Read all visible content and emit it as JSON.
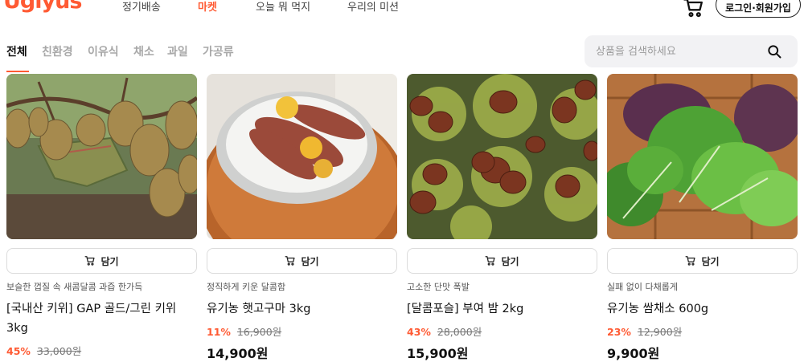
{
  "header": {
    "logo_text": "Uglyus",
    "nav": [
      "정기배송",
      "마켓",
      "오늘 뭐 먹지",
      "우리의 미션"
    ],
    "active_nav": "마켓",
    "login_label": "로그인·회원가입",
    "accent_color": "#ff5a33"
  },
  "categories": {
    "tabs": [
      "전체",
      "친환경",
      "이유식",
      "채소",
      "과일",
      "가공류"
    ],
    "active": "전체"
  },
  "search": {
    "placeholder": "상품을 검색하세요"
  },
  "products": [
    {
      "image": "kiwi-photo",
      "add_label": "담기",
      "subtitle": "보슬한 껍질 속 새콤달콤 과즙 한가득",
      "title": "[국내산 키위] GAP 골드/그린 키위 3kg",
      "discount": "45%",
      "original_price": "33,000원",
      "price": ""
    },
    {
      "image": "sweet-potato-photo",
      "add_label": "담기",
      "subtitle": "정직하게 키운 달콤함",
      "title": "유기농 햇고구마 3kg",
      "discount": "11%",
      "original_price": "16,900원",
      "price": "14,900원"
    },
    {
      "image": "chestnut-photo",
      "add_label": "담기",
      "subtitle": "고소한 단맛 폭발",
      "title": "[달콤포슬] 부여 밤 2kg",
      "discount": "43%",
      "original_price": "28,000원",
      "price": "15,900원"
    },
    {
      "image": "lettuce-photo",
      "add_label": "담기",
      "subtitle": "실패 없이 다채롭게",
      "title": "유기농 쌈채소 600g",
      "discount": "23%",
      "original_price": "12,900원",
      "price": "9,900원"
    }
  ]
}
